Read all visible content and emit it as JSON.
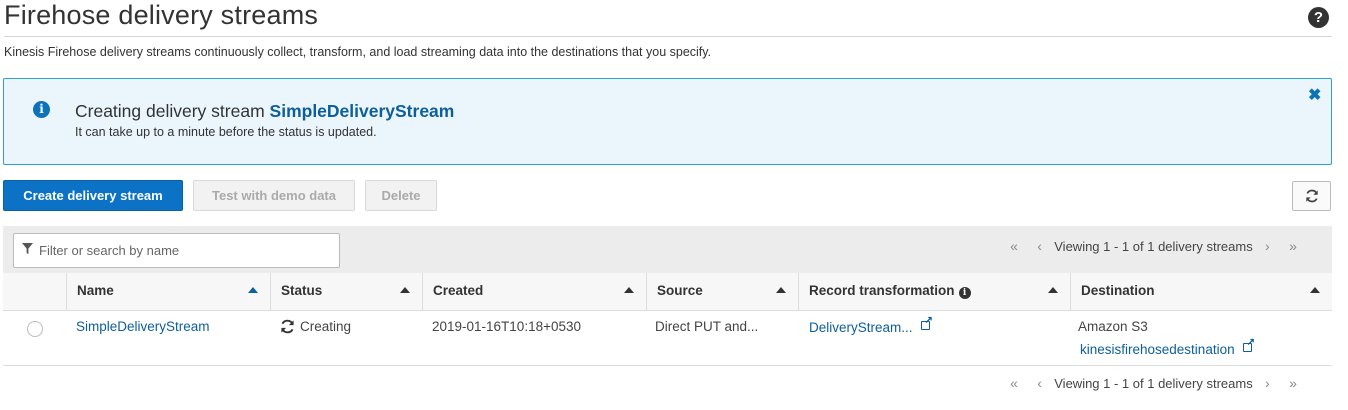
{
  "header": {
    "title": "Firehose delivery streams",
    "description": "Kinesis Firehose delivery streams continuously collect, transform, and load streaming data into the destinations that you specify.",
    "help_icon": "help-icon"
  },
  "flash": {
    "title_prefix": "Creating delivery stream ",
    "title_stream": "SimpleDeliveryStream",
    "subtitle": "It can take up to a minute before the status is updated.",
    "close_glyph": "✖",
    "color": "#2e9fcf"
  },
  "toolbar": {
    "create_label": "Create delivery stream",
    "demo_label": "Test with demo data",
    "delete_label": "Delete",
    "refresh_icon": "refresh-icon",
    "primary_color": "#0b72c6"
  },
  "table": {
    "filter_placeholder": "Filter or search by name",
    "pager_text": "Viewing 1 - 1 of 1 delivery streams",
    "columns": {
      "name": "Name",
      "status": "Status",
      "created": "Created",
      "source": "Source",
      "transformation": "Record transformation",
      "destination": "Destination"
    },
    "rows": [
      {
        "name": "SimpleDeliveryStream",
        "status": "Creating",
        "created": "2019-01-16T10:18+0530",
        "source": "Direct PUT and...",
        "transformation": "DeliveryStream...",
        "destination_type": "Amazon S3",
        "destination_name": "kinesisfirehosedestination"
      }
    ]
  }
}
